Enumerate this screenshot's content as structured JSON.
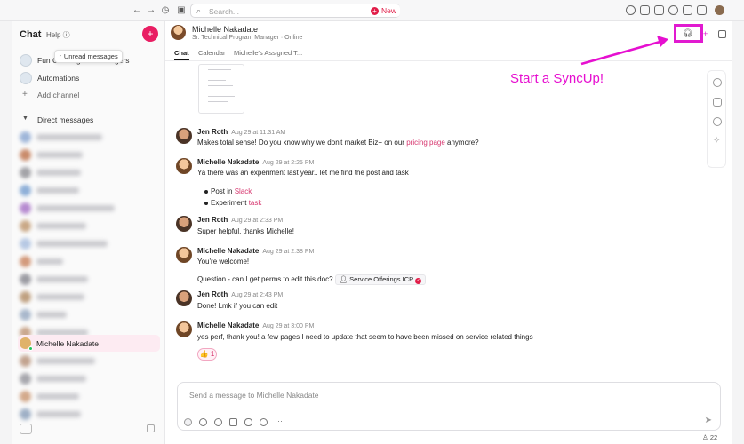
{
  "search": {
    "placeholder": "Search..."
  },
  "toolbar": {
    "new_label": "New"
  },
  "sidebar": {
    "title": "Chat",
    "help": "Help",
    "tooltip": "Unread messages",
    "channels": [
      {
        "label": "Fun Co-Program Managers"
      },
      {
        "label": "Automations"
      },
      {
        "label": "Add channel"
      }
    ],
    "dm_header": "Direct messages",
    "active_dm": "Michelle Nakadate"
  },
  "conversation": {
    "name": "Michelle Nakadate",
    "subtitle": "Sr. Technical Program Manager · Online",
    "tabs": [
      "Chat",
      "Calendar",
      "Michelle's Assigned T..."
    ]
  },
  "messages": [
    {
      "author": "Jen Roth",
      "time": "Aug 29 at 11:31 AM",
      "text_before": "Makes total sense! Do you know why we don't market Biz+ on our ",
      "link": "pricing page",
      "text_after": " anymore?"
    },
    {
      "author": "Michelle Nakadate",
      "time": "Aug 29 at 2:25 PM",
      "text": "Ya there was an experiment last year.. let me find the post and task",
      "bullets": [
        {
          "prefix": "Post in ",
          "link": "Slack"
        },
        {
          "prefix": "Experiment ",
          "link": "task"
        }
      ]
    },
    {
      "author": "Jen Roth",
      "time": "Aug 29 at 2:33 PM",
      "text": "Super helpful, thanks Michelle!"
    },
    {
      "author": "Michelle Nakadate",
      "time": "Aug 29 at 2:38 PM",
      "text": "You're welcome!",
      "question": "Question - can I get perms to edit this doc?",
      "chip": "Service Offerings ICP"
    },
    {
      "author": "Jen Roth",
      "time": "Aug 29 at 2:43 PM",
      "text": "Done! Lmk if you can edit"
    },
    {
      "author": "Michelle Nakadate",
      "time": "Aug 29 at 3:00 PM",
      "text": "yes perf, thank you! a few pages I need to update that seem to have been missed on service related things",
      "reaction": "👍 1"
    }
  ],
  "composer": {
    "placeholder": "Send a message to Michelle Nakadate"
  },
  "annotation": "Start a SyncUp!",
  "footer": {
    "badge": "22"
  },
  "colors": {
    "accent": "#e91e63",
    "highlight": "#e11ad0",
    "link": "#d6336c"
  }
}
